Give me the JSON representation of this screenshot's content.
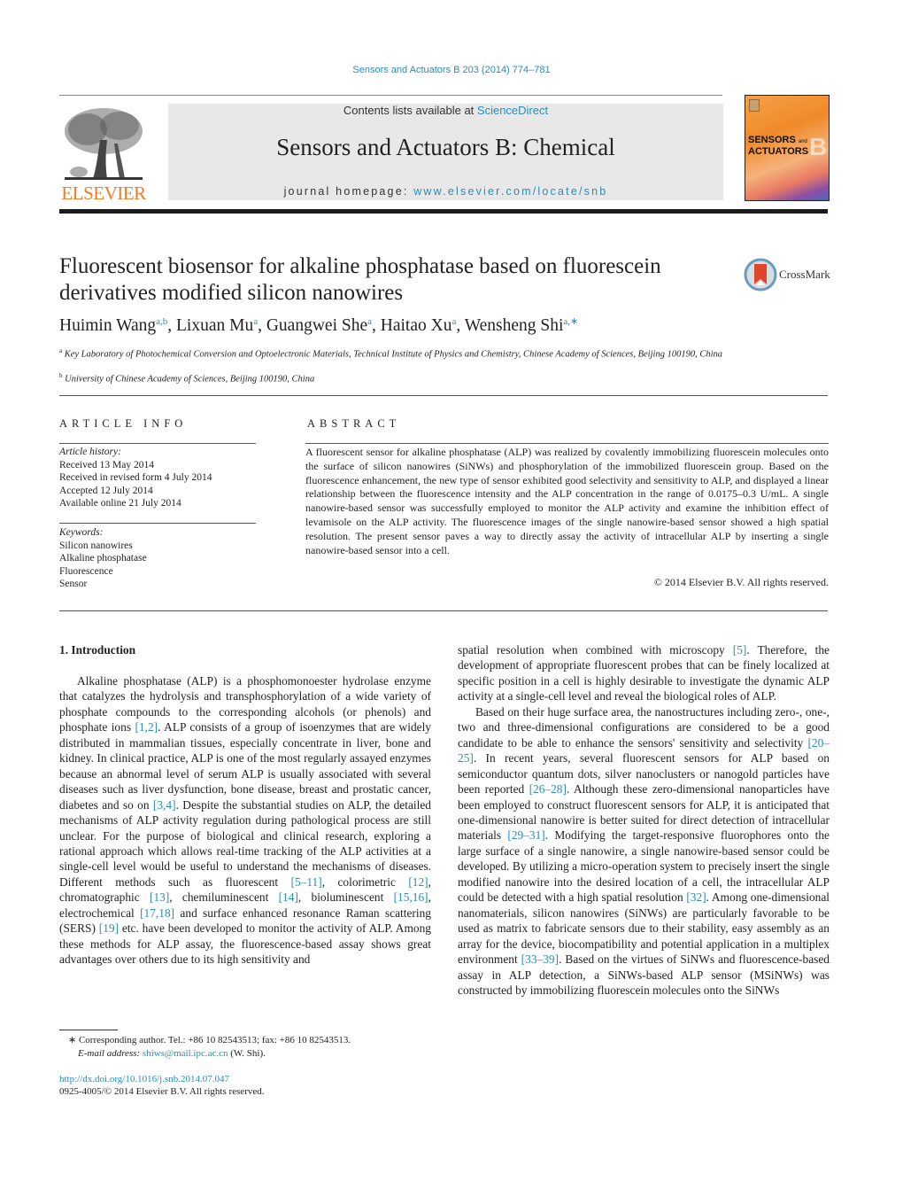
{
  "header": {
    "citation": "Sensors and Actuators B 203 (2014) 774–781",
    "contents_prefix": "Contents lists available at ",
    "contents_link": "ScienceDirect",
    "journal_title": "Sensors and Actuators B: Chemical",
    "homepage_prefix": "journal homepage: ",
    "homepage_link": "www.elsevier.com/locate/snb",
    "publisher_logo": "ELSEVIER",
    "cover_line1": "SENSORS",
    "cover_and": "and",
    "cover_line2": "ACTUATORS",
    "cover_letter": "B",
    "crossmark_label": "CrossMark"
  },
  "article": {
    "title": "Fluorescent biosensor for alkaline phosphatase based on fluorescein derivatives modified silicon nanowires",
    "authors": [
      {
        "name": "Huimin Wang",
        "sup": "a,b",
        "sep": ", "
      },
      {
        "name": "Lixuan Mu",
        "sup": "a",
        "sep": ", "
      },
      {
        "name": "Guangwei She",
        "sup": "a",
        "sep": ", "
      },
      {
        "name": "Haitao Xu",
        "sup": "a",
        "sep": ", "
      },
      {
        "name": "Wensheng Shi",
        "sup": "a,∗",
        "sep": ""
      }
    ],
    "affiliations": [
      {
        "mark": "a",
        "text": "Key Laboratory of Photochemical Conversion and Optoelectronic Materials, Technical Institute of Physics and Chemistry, Chinese Academy of Sciences, Beijing 100190, China"
      },
      {
        "mark": "b",
        "text": "University of Chinese Academy of Sciences, Beijing 100190, China"
      }
    ]
  },
  "article_info": {
    "heading": "ARTICLE INFO",
    "history_label": "Article history:",
    "history": [
      "Received 13 May 2014",
      "Received in revised form 4 July 2014",
      "Accepted 12 July 2014",
      "Available online 21 July 2014"
    ],
    "keywords_label": "Keywords:",
    "keywords": [
      "Silicon nanowires",
      "Alkaline phosphatase",
      "Fluorescence",
      "Sensor"
    ]
  },
  "abstract": {
    "heading": "ABSTRACT",
    "text": "A fluorescent sensor for alkaline phosphatase (ALP) was realized by covalently immobilizing fluorescein molecules onto the surface of silicon nanowires (SiNWs) and phosphorylation of the immobilized fluorescein group. Based on the fluorescence enhancement, the new type of sensor exhibited good selectivity and sensitivity to ALP, and displayed a linear relationship between the fluorescence intensity and the ALP concentration in the range of 0.0175–0.3 U/mL. A single nanowire-based sensor was successfully employed to monitor the ALP activity and examine the inhibition effect of levamisole on the ALP activity. The fluorescence images of the single nanowire-based sensor showed a high spatial resolution. The present sensor paves a way to directly assay the activity of intracellular ALP by inserting a single nanowire-based sensor into a cell.",
    "copyright": "© 2014 Elsevier B.V. All rights reserved."
  },
  "introduction": {
    "heading": "1.  Introduction",
    "left_col": [
      {
        "t": "Alkaline phosphatase (ALP) is a phosphomonoester hydrolase enzyme that catalyzes the hydrolysis and transphosphorylation of a wide variety of phosphate compounds to the corresponding alcohols (or phenols) and phosphate ions "
      },
      {
        "c": "[1,2]"
      },
      {
        "t": ". ALP consists of a group of isoenzymes that are widely distributed in mammalian tissues, especially concentrate in liver, bone and kidney. In clinical practice, ALP is one of the most regularly assayed enzymes because an abnormal level of serum ALP is usually associated with several diseases such as liver dysfunction, bone disease, breast and prostatic cancer, diabetes and so on "
      },
      {
        "c": "[3,4]"
      },
      {
        "t": ". Despite the substantial studies on ALP, the detailed mechanisms of ALP activity regulation during pathological process are still unclear. For the purpose of biological and clinical research, exploring a rational approach which allows real-time tracking of the ALP activities at a single-cell level would be useful to understand the mechanisms of diseases. Different methods such as fluorescent "
      },
      {
        "c": "[5–11]"
      },
      {
        "t": ", colorimetric "
      },
      {
        "c": "[12]"
      },
      {
        "t": ", chromatographic "
      },
      {
        "c": "[13]"
      },
      {
        "t": ", chemiluminescent "
      },
      {
        "c": "[14]"
      },
      {
        "t": ", bioluminescent "
      },
      {
        "c": "[15,16]"
      },
      {
        "t": ", electrochemical "
      },
      {
        "c": "[17,18]"
      },
      {
        "t": " and surface enhanced resonance Raman scattering (SERS) "
      },
      {
        "c": "[19]"
      },
      {
        "t": " etc. have been developed to monitor the activity of ALP. Among these methods for ALP assay, the fluorescence-based assay shows great advantages over others due to its high sensitivity and"
      }
    ],
    "right_col_p1": [
      {
        "t": "spatial resolution when combined with microscopy "
      },
      {
        "c": "[5]"
      },
      {
        "t": ". Therefore, the development of appropriate fluorescent probes that can be finely localized at specific position in a cell is highly desirable to investigate the dynamic ALP activity at a single-cell level and reveal the biological roles of ALP."
      }
    ],
    "right_col_p2": [
      {
        "t": "Based on their huge surface area, the nanostructures including zero-, one-, two and three-dimensional configurations are considered to be a good candidate to be able to enhance the sensors' sensitivity and selectivity "
      },
      {
        "c": "[20–25]"
      },
      {
        "t": ". In recent years, several fluorescent sensors for ALP based on semiconductor quantum dots, silver nanoclusters or nanogold particles have been reported "
      },
      {
        "c": "[26–28]"
      },
      {
        "t": ". Although these zero-dimensional nanoparticles have been employed to construct fluorescent sensors for ALP, it is anticipated that one-dimensional nanowire is better suited for direct detection of intracellular materials "
      },
      {
        "c": "[29–31]"
      },
      {
        "t": ". Modifying the target-responsive fluorophores onto the large surface of a single nanowire, a single nanowire-based sensor could be developed. By utilizing a micro-operation system to precisely insert the single modified nanowire into the desired location of a cell, the intracellular ALP could be detected with a high spatial resolution "
      },
      {
        "c": "[32]"
      },
      {
        "t": ". Among one-dimensional nanomaterials, silicon nanowires (SiNWs) are particularly favorable to be used as matrix to fabricate sensors due to their stability, easy assembly as an array for the device, biocompatibility and potential application in a multiplex environment "
      },
      {
        "c": "[33–39]"
      },
      {
        "t": ". Based on the virtues of SiNWs and fluorescence-based assay in ALP detection, a SiNWs-based ALP sensor (MSiNWs) was constructed by immobilizing fluorescein molecules onto the SiNWs"
      }
    ]
  },
  "footnotes": {
    "corresponding": "∗  Corresponding author. Tel.: +86 10 82543513; fax: +86 10 82543513.",
    "email_label": "E-mail address: ",
    "email": "shiws@mail.ipc.ac.cn",
    "email_suffix": " (W. Shi).",
    "doi": "http://dx.doi.org/10.1016/j.snb.2014.07.047",
    "issn": "0925-4005/© 2014 Elsevier B.V. All rights reserved."
  },
  "colors": {
    "link": "#2a8cb8",
    "elsevier_orange": "#f47920",
    "banner_gray": "#e8e8e8"
  }
}
